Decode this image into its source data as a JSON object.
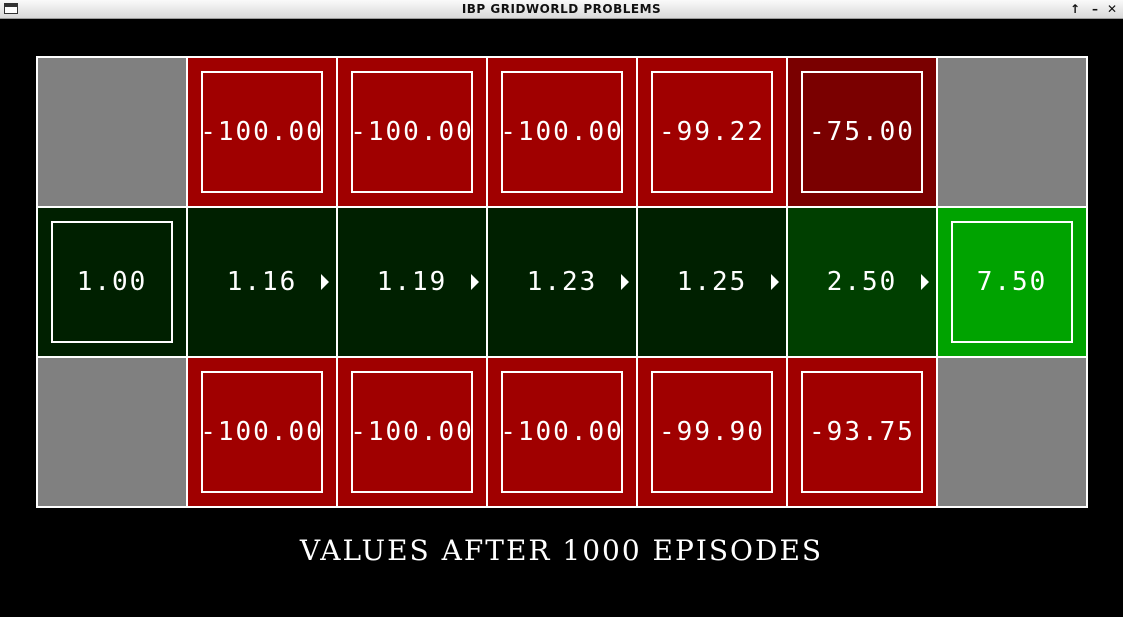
{
  "window": {
    "title": "IBP GRIDWORLD PROBLEMS",
    "controls": {
      "maximize": "↑",
      "minimize": "–",
      "close": "✕"
    }
  },
  "grid": {
    "rows": 3,
    "cols": 7,
    "cells": [
      [
        {
          "kind": "wall"
        },
        {
          "kind": "value",
          "value": "-100.00",
          "color": "#a00000",
          "boxed": true
        },
        {
          "kind": "value",
          "value": "-100.00",
          "color": "#a00000",
          "boxed": true
        },
        {
          "kind": "value",
          "value": "-100.00",
          "color": "#a00000",
          "boxed": true
        },
        {
          "kind": "value",
          "value": "-99.22",
          "color": "#a00000",
          "boxed": true
        },
        {
          "kind": "value",
          "value": "-75.00",
          "color": "#7a0000",
          "boxed": true
        },
        {
          "kind": "wall"
        }
      ],
      [
        {
          "kind": "value",
          "value": "1.00",
          "color": "#002000",
          "boxed": true
        },
        {
          "kind": "value",
          "value": "1.16",
          "color": "#002000",
          "arrow": "right"
        },
        {
          "kind": "value",
          "value": "1.19",
          "color": "#002000",
          "arrow": "right"
        },
        {
          "kind": "value",
          "value": "1.23",
          "color": "#002000",
          "arrow": "right"
        },
        {
          "kind": "value",
          "value": "1.25",
          "color": "#002000",
          "arrow": "right"
        },
        {
          "kind": "value",
          "value": "2.50",
          "color": "#003f00",
          "arrow": "right"
        },
        {
          "kind": "value",
          "value": "7.50",
          "color": "#00a300",
          "boxed": true
        }
      ],
      [
        {
          "kind": "wall"
        },
        {
          "kind": "value",
          "value": "-100.00",
          "color": "#a00000",
          "boxed": true
        },
        {
          "kind": "value",
          "value": "-100.00",
          "color": "#a00000",
          "boxed": true
        },
        {
          "kind": "value",
          "value": "-100.00",
          "color": "#a00000",
          "boxed": true
        },
        {
          "kind": "value",
          "value": "-99.90",
          "color": "#a00000",
          "boxed": true
        },
        {
          "kind": "value",
          "value": "-93.75",
          "color": "#a00000",
          "boxed": true
        },
        {
          "kind": "wall"
        }
      ]
    ],
    "colors": {
      "wall": "#808080",
      "grid_lines": "#ffffff",
      "background": "#000000"
    }
  },
  "caption": "VALUES AFTER 1000 EPISODES"
}
